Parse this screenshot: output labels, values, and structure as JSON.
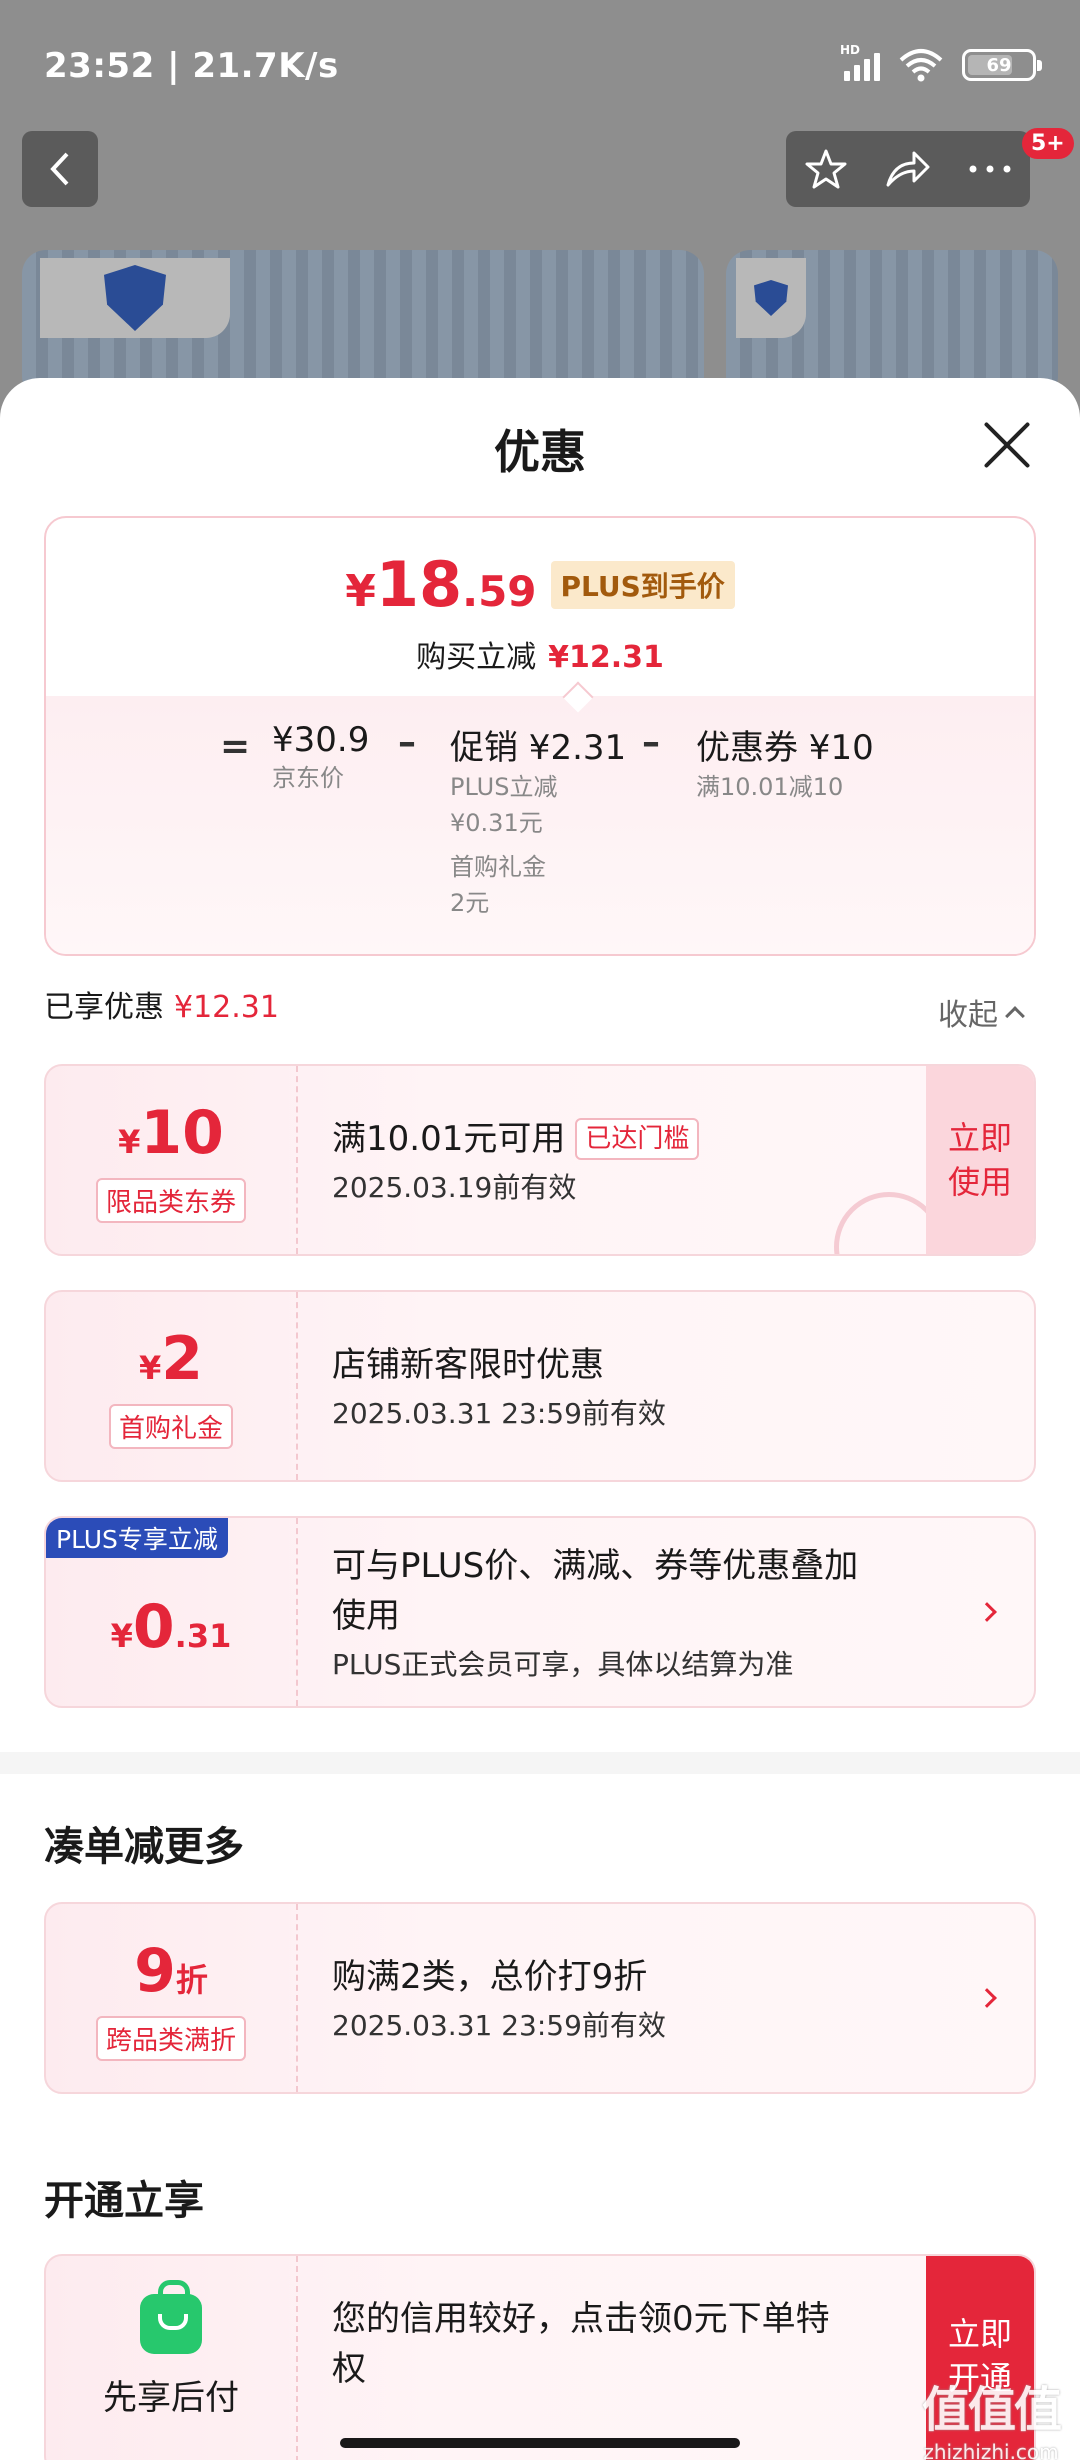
{
  "status_bar": {
    "time": "23:52 | 21.7K/s",
    "network": "HD",
    "battery": "69"
  },
  "top_bar": {
    "badge": "5+"
  },
  "sheet": {
    "title": "优惠",
    "final_price": {
      "yen": "¥",
      "integer": "18",
      "decimal": ".59",
      "tag": "PLUS到手价"
    },
    "reduce_label": "购买立减",
    "reduce_amount": "¥12.31",
    "formula": {
      "eq": "=",
      "jd_price": "¥30.9",
      "jd_price_label": "京东价",
      "minus1": "–",
      "promo": "促销 ¥2.31",
      "promo_sub1": "PLUS立减",
      "promo_sub1b": "¥0.31元",
      "promo_sub2": "首购礼金",
      "promo_sub2b": "2元",
      "minus2": "–",
      "coupon": "优惠券 ¥10",
      "coupon_sub": "满10.01减10"
    },
    "enjoyed_label": "已享优惠",
    "enjoyed_amount": "¥12.31",
    "collapse_label": "收起",
    "cards": [
      {
        "yen": "¥",
        "amount": "10",
        "tag": "限品类东券",
        "title": "满10.01元可用",
        "reached": "已达门槛",
        "desc": "2025.03.19前有效",
        "button": "立即\n使用"
      },
      {
        "yen": "¥",
        "amount": "2",
        "tag": "首购礼金",
        "title": "店铺新客限时优惠",
        "desc": "2025.03.31 23:59前有效"
      },
      {
        "ribbon": "PLUS专享立减",
        "yen": "¥",
        "amount": "0",
        "amount_dec": ".31",
        "title": "可与PLUS价、满减、券等优惠叠加",
        "title2": "使用",
        "desc": "PLUS正式会员可享，具体以结算为准"
      }
    ],
    "section_more": "凑单减更多",
    "more_card": {
      "amount": "9",
      "unit": "折",
      "tag": "跨品类满折",
      "title": "购满2类，总价打9折",
      "desc": "2025.03.31 23:59前有效"
    },
    "section_open": "开通立享",
    "open_card": {
      "label": "先享后付",
      "title": "您的信用较好，点击领0元下单特",
      "title2": "权",
      "button": "立即\n开通"
    }
  },
  "watermark": {
    "line1": "值值值",
    "line2": "zhizhizhi.com"
  },
  "colors": {
    "accent": "#e4263a",
    "plus_blue": "#2b4cb8",
    "green": "#27c86d"
  }
}
